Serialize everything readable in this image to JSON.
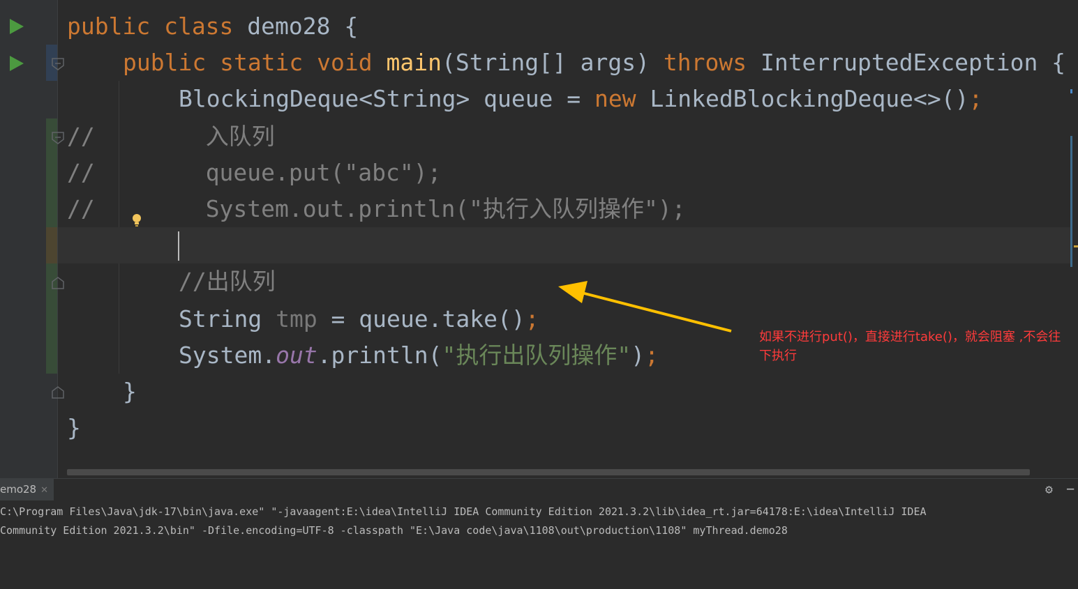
{
  "editor": {
    "lines": [
      {
        "tokens": [
          [
            "kw",
            "public "
          ],
          [
            "kw",
            "class "
          ],
          [
            "plain",
            "demo28 {"
          ]
        ]
      },
      {
        "tokens": [
          [
            "kw",
            "public "
          ],
          [
            "kw",
            "static "
          ],
          [
            "kw",
            "void "
          ],
          [
            "fn",
            "main"
          ],
          [
            "plain",
            "(String[] args) "
          ],
          [
            "kw",
            "throws "
          ],
          [
            "plain",
            "InterruptedException {"
          ]
        ]
      },
      {
        "tokens": [
          [
            "plain",
            "BlockingDeque<String> queue = "
          ],
          [
            "kw",
            "new "
          ],
          [
            "plain",
            "LinkedBlockingDeque<>()"
          ],
          [
            "kw",
            ";"
          ]
        ]
      },
      {
        "tokens": [
          [
            "cmt",
            "//"
          ],
          [
            "cmt",
            "        入队列"
          ]
        ]
      },
      {
        "tokens": [
          [
            "cmt",
            "//"
          ],
          [
            "cmt",
            "        queue.put(\"abc\");"
          ]
        ]
      },
      {
        "tokens": [
          [
            "cmt",
            "//"
          ],
          [
            "cmt",
            "        System.out.println(\"执行入队列操作\");"
          ]
        ]
      },
      {
        "tokens": []
      },
      {
        "tokens": [
          [
            "cmt",
            "//出队列"
          ]
        ]
      },
      {
        "tokens": [
          [
            "plain",
            "String "
          ],
          [
            "unused",
            "tmp"
          ],
          [
            "plain",
            " = queue.take()"
          ],
          [
            "kw",
            ";"
          ]
        ]
      },
      {
        "tokens": [
          [
            "plain",
            "System."
          ],
          [
            "fld",
            "out"
          ],
          [
            "plain",
            ".println("
          ],
          [
            "str",
            "\"执行出队列操作\""
          ],
          [
            "plain",
            ")"
          ],
          [
            "kw",
            ";"
          ]
        ]
      },
      {
        "tokens": [
          [
            "plain",
            "}"
          ]
        ]
      },
      {
        "tokens": [
          [
            "plain",
            "}"
          ]
        ]
      }
    ]
  },
  "annotation": {
    "text": "如果不进行put()，直接进行take()，就会阻塞 ,不会往下执行",
    "color": "#ff3b3b",
    "arrow_color": "#ffc000"
  },
  "run_panel": {
    "tab_label": "emo28",
    "close_icon": "close-icon",
    "console_lines": [
      "C:\\Program Files\\Java\\jdk-17\\bin\\java.exe\" \"-javaagent:E:\\idea\\IntelliJ IDEA Community Edition 2021.3.2\\lib\\idea_rt.jar=64178:E:\\idea\\IntelliJ IDEA",
      "Community Edition 2021.3.2\\bin\" -Dfile.encoding=UTF-8 -classpath \"E:\\Java code\\java\\1108\\out\\production\\1108\" myThread.demo28"
    ]
  },
  "colors": {
    "background": "#2b2b2b",
    "keyword": "#cc7832",
    "function": "#ffc66d",
    "string": "#6a8759",
    "comment": "#808080",
    "run_icon": "#4c9a40"
  }
}
